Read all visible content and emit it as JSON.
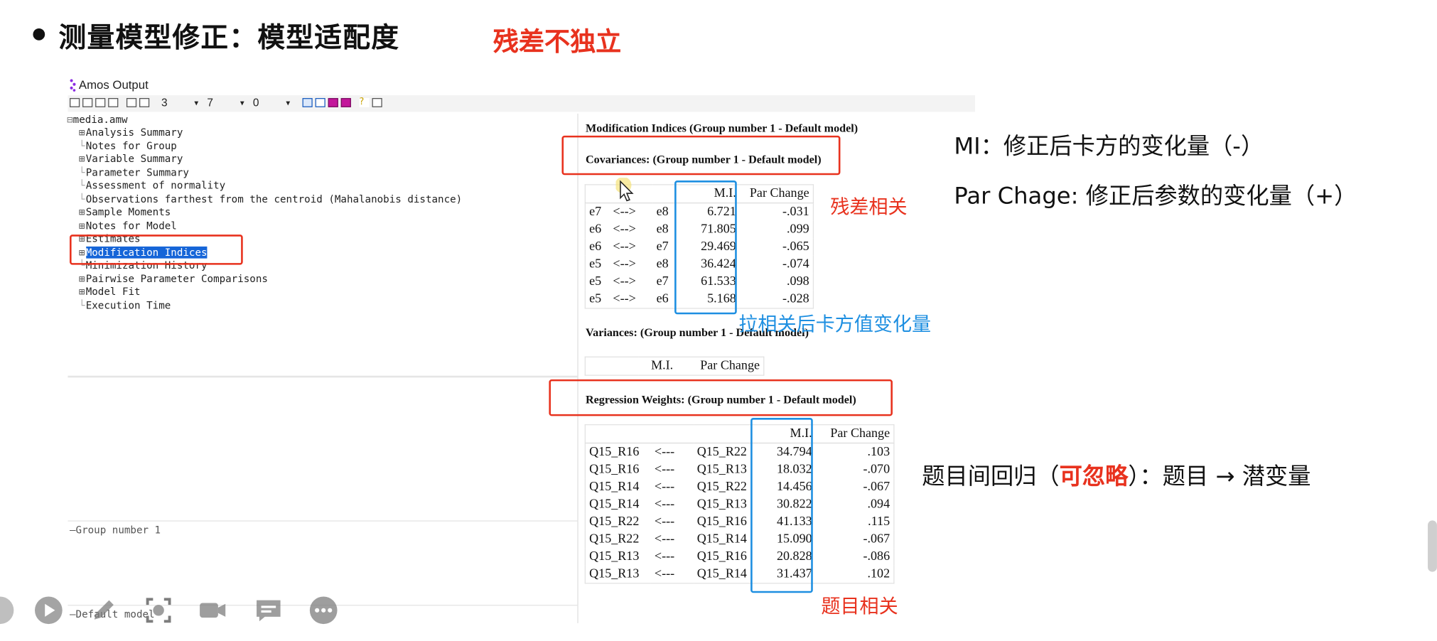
{
  "slide": {
    "title": "测量模型修正：模型适配度",
    "subtitle_red": "残差不独立"
  },
  "window": {
    "title": "Amos Output",
    "toolbar_numbers": [
      "3",
      "7",
      "0"
    ]
  },
  "tree": {
    "root": "media.amw",
    "items": [
      {
        "label": "Analysis Summary",
        "expandable": true
      },
      {
        "label": "Notes for Group",
        "expandable": false
      },
      {
        "label": "Variable Summary",
        "expandable": true
      },
      {
        "label": "Parameter Summary",
        "expandable": false
      },
      {
        "label": "Assessment of normality",
        "expandable": false
      },
      {
        "label": "Observations farthest from the centroid (Mahalanobis distance)",
        "expandable": false
      },
      {
        "label": "Sample Moments",
        "expandable": true
      },
      {
        "label": "Notes for Model",
        "expandable": true
      },
      {
        "label": "Estimates",
        "expandable": true
      },
      {
        "label": "Modification Indices",
        "expandable": true,
        "selected": true
      },
      {
        "label": "Minimization History",
        "expandable": false
      },
      {
        "label": "Pairwise Parameter Comparisons",
        "expandable": true
      },
      {
        "label": "Model Fit",
        "expandable": true
      },
      {
        "label": "Execution Time",
        "expandable": false
      }
    ],
    "group_label": "Group number 1",
    "model_label": "Default model"
  },
  "output": {
    "heading": "Modification Indices (Group number 1 - Default model)",
    "covariances": {
      "heading": "Covariances: (Group number 1 - Default model)",
      "headers": [
        "M.I.",
        "Par Change"
      ],
      "rows": [
        [
          "e7",
          "<-->",
          "e8",
          "6.721",
          "-.031"
        ],
        [
          "e6",
          "<-->",
          "e8",
          "71.805",
          ".099"
        ],
        [
          "e6",
          "<-->",
          "e7",
          "29.469",
          "-.065"
        ],
        [
          "e5",
          "<-->",
          "e8",
          "36.424",
          "-.074"
        ],
        [
          "e5",
          "<-->",
          "e7",
          "61.533",
          ".098"
        ],
        [
          "e5",
          "<-->",
          "e6",
          "5.168",
          "-.028"
        ]
      ]
    },
    "variances": {
      "heading": "Variances: (Group number 1 - Default model)",
      "headers": [
        "M.I.",
        "Par Change"
      ]
    },
    "regression": {
      "heading": "Regression Weights: (Group number 1 - Default model)",
      "headers": [
        "M.I.",
        "Par Change"
      ],
      "rows": [
        [
          "Q15_R16",
          "<---",
          "Q15_R22",
          "34.794",
          ".103"
        ],
        [
          "Q15_R16",
          "<---",
          "Q15_R13",
          "18.032",
          "-.070"
        ],
        [
          "Q15_R14",
          "<---",
          "Q15_R22",
          "14.456",
          "-.067"
        ],
        [
          "Q15_R14",
          "<---",
          "Q15_R13",
          "30.822",
          ".094"
        ],
        [
          "Q15_R22",
          "<---",
          "Q15_R16",
          "41.133",
          ".115"
        ],
        [
          "Q15_R22",
          "<---",
          "Q15_R14",
          "15.090",
          "-.067"
        ],
        [
          "Q15_R13",
          "<---",
          "Q15_R16",
          "20.828",
          "-.086"
        ],
        [
          "Q15_R13",
          "<---",
          "Q15_R14",
          "31.437",
          ".102"
        ]
      ]
    }
  },
  "annotations": {
    "mi_note": "MI：修正后卡方的变化量（-）",
    "par_note": "Par Chage: 修正后参数的变化量（+）",
    "residual_corr": "残差相关",
    "chi_change": "拉相关后卡方值变化量",
    "item_corr": "题目相关",
    "regression_note_prefix": "题目间回归（",
    "regression_note_bold": "可忽略",
    "regression_note_suffix": "）：题目 → 潜变量"
  },
  "colors": {
    "annotation_red": "#e8321e",
    "annotation_blue": "#1e8fe1",
    "selection": "#1565d8"
  },
  "controls": [
    "play-icon",
    "pen-icon",
    "screenshot-icon",
    "camera-icon",
    "comment-icon",
    "more-icon"
  ]
}
